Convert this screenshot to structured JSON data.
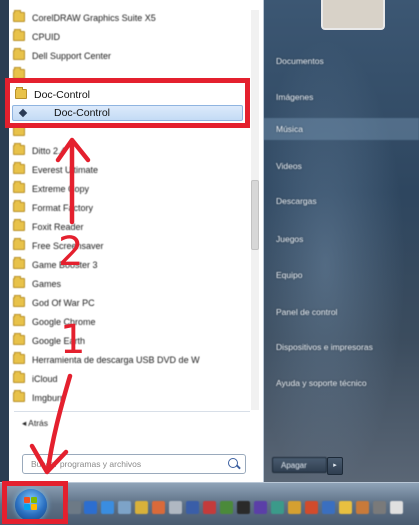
{
  "start_menu": {
    "programs": [
      "CorelDRAW Graphics Suite X5",
      "CPUID",
      "Dell Support Center",
      "",
      "",
      "",
      "Ditto 2.4",
      "Everest Ultimate",
      "Extreme Copy",
      "Format Factory",
      "Foxit Reader",
      "Free Screensaver",
      "Game Booster 3",
      "Games",
      "God Of War PC",
      "Google Chrome",
      "Google Earth",
      "Herramienta de descarga USB DVD de W",
      "iCloud",
      "Imgburn"
    ],
    "back_label": "Atrás",
    "search_placeholder": "Buscar programas y archivos",
    "highlight": {
      "folder_label": "Doc-Control",
      "item_label": "Doc-Control"
    },
    "right_links": [
      "Documentos",
      "Imágenes",
      "Música",
      "Videos",
      "Descargas",
      "Juegos",
      "Equipo",
      "Panel de control",
      "Dispositivos e impresoras",
      "Ayuda y soporte técnico"
    ],
    "active_right_link": "Música",
    "shutdown_label": "Apagar",
    "shutdown_arrow": "▸"
  },
  "annotations": {
    "step_1": "1",
    "step_2": "2",
    "color": "#e4202e"
  },
  "taskbar": {
    "icons": [
      "gear-icon",
      "app-icon",
      "app-icon",
      "app-icon",
      "app-icon",
      "app-icon",
      "app-icon",
      "app-icon",
      "app-icon",
      "app-icon",
      "app-icon",
      "app-icon",
      "app-icon",
      "app-icon",
      "app-icon",
      "app-icon",
      "app-icon",
      "app-icon",
      "app-icon",
      "app-icon"
    ]
  }
}
